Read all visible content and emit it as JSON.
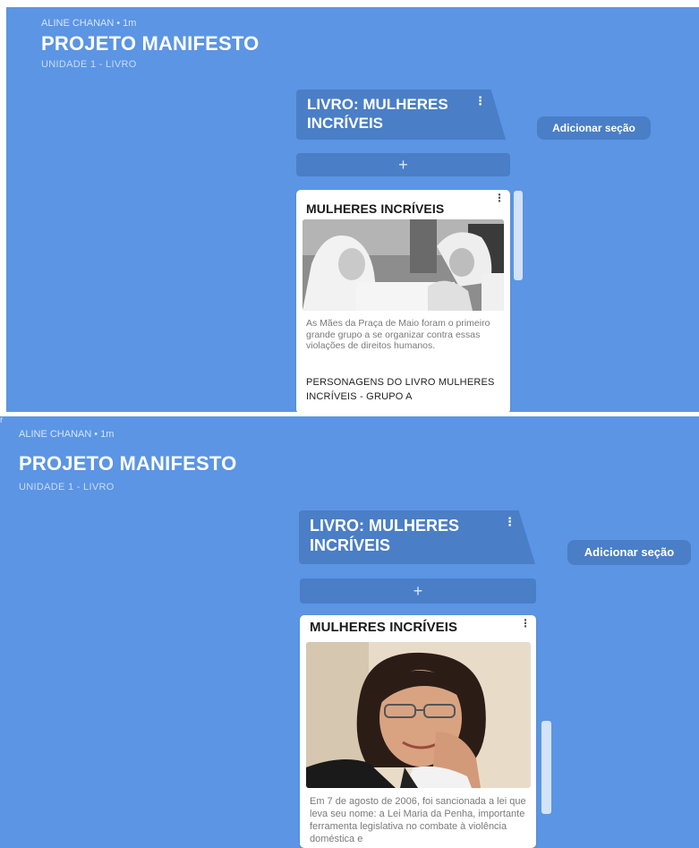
{
  "page_title": "",
  "colors": {
    "background": "#5b95e4",
    "section": "#4a7ec6",
    "card": "#ffffff"
  },
  "panels": [
    {
      "author": "ALINE CHANAN",
      "time": "1m",
      "title": "PROJETO MANIFESTO",
      "unit": "UNIDADE 1 - LIVRO",
      "section_title": "LIVRO: MULHERES INCRÍVEIS",
      "section_menu": "⋮",
      "add_section_label": "Adicionar seção",
      "add_post_label": "+",
      "card": {
        "title": "MULHERES INCRÍVEIS",
        "menu": "⋮",
        "description": "As Mães da Praça de Maio foram o primeiro grande grupo a se organizar contra essas violações de direitos humanos.",
        "subtitle": "PERSONAGENS DO LIVRO MULHERES INCRÍVEIS - GRUPO A"
      }
    },
    {
      "corner": "r",
      "author": "ALINE CHANAN",
      "time": "1m",
      "title": "PROJETO MANIFESTO",
      "unit": "UNIDADE 1 - LIVRO",
      "section_title": "LIVRO: MULHERES INCRÍVEIS",
      "section_menu": "⋮",
      "add_section_label": "Adicionar seção",
      "add_post_label": "+",
      "card": {
        "title": "MULHERES INCRÍVEIS",
        "menu": "⋮",
        "description": "Em 7 de agosto de 2006, foi sancionada a lei que leva seu nome: a Lei Maria da Penha, importante ferramenta legislativa no combate à violência doméstica e"
      }
    }
  ]
}
